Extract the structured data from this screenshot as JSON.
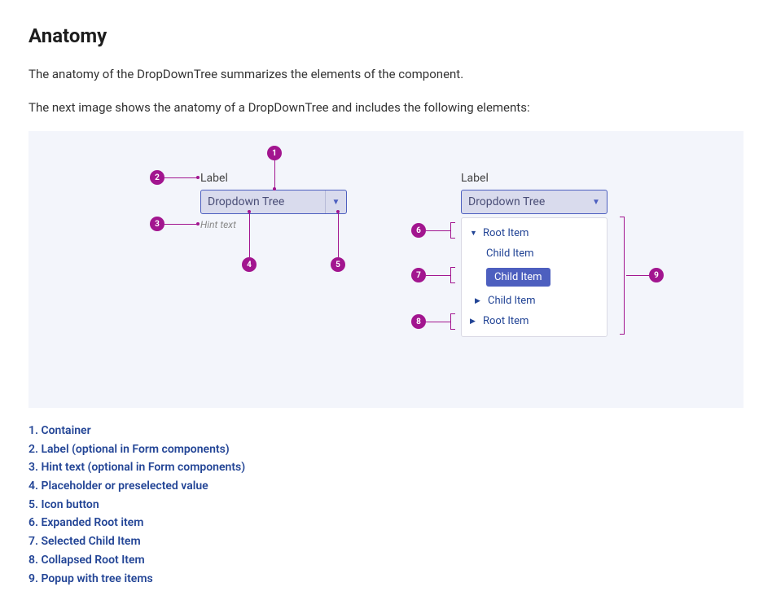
{
  "heading": "Anatomy",
  "para1": "The anatomy of the DropDownTree summarizes the elements of the component.",
  "para2": "The next image shows the anatomy of a DropDownTree and includes the following elements:",
  "left": {
    "label": "Label",
    "field": "Dropdown Tree",
    "hint": "Hint text"
  },
  "right": {
    "label": "Label",
    "field": "Dropdown Tree",
    "tree": {
      "root1": "Root Item",
      "child1": "Child Item",
      "child2_selected": "Child Item",
      "child3": "Child Item",
      "root2": "Root Item"
    }
  },
  "badges": {
    "b1": "1",
    "b2": "2",
    "b3": "3",
    "b4": "4",
    "b5": "5",
    "b6": "6",
    "b7": "7",
    "b8": "8",
    "b9": "9"
  },
  "legend": {
    "i1": "1. Container",
    "i2": "2. Label (optional in Form components)",
    "i3": "3. Hint text (optional in Form components)",
    "i4": "4. Placeholder or preselected value",
    "i5": "5. Icon button",
    "i6": "6. Expanded Root item",
    "i7": "7. Selected Child Item",
    "i8": "8. Collapsed Root Item",
    "i9": "9. Popup with tree items"
  }
}
